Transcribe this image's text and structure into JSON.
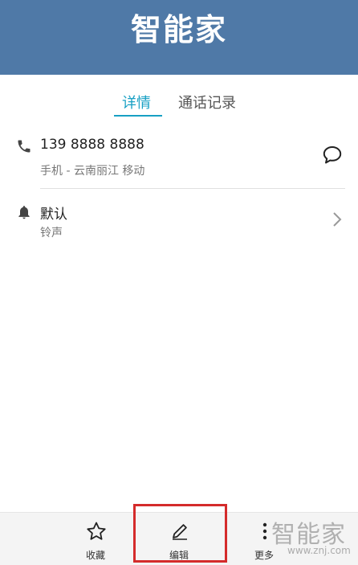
{
  "header": {
    "title": "智能家"
  },
  "tabs": [
    {
      "label": "详情",
      "active": true
    },
    {
      "label": "通话记录",
      "active": false
    }
  ],
  "phone": {
    "number": "139 8888 8888",
    "detail": "手机 - 云南丽江 移动",
    "icon": "phone-icon",
    "action_icon": "message-icon"
  },
  "ringtone": {
    "value": "默认",
    "label": "铃声",
    "icon": "bell-icon",
    "action_icon": "chevron-right-icon"
  },
  "bottom_bar": {
    "favorite": {
      "label": "收藏",
      "icon": "star-icon"
    },
    "edit": {
      "label": "编辑",
      "icon": "pencil-icon"
    },
    "more": {
      "label": "更多",
      "icon": "more-vertical-icon"
    }
  },
  "watermark": {
    "title": "智能家",
    "url": "www.znj.com"
  },
  "colors": {
    "header_bg": "#4f79a7",
    "accent": "#18a0c4",
    "highlight": "#d42b2b"
  }
}
